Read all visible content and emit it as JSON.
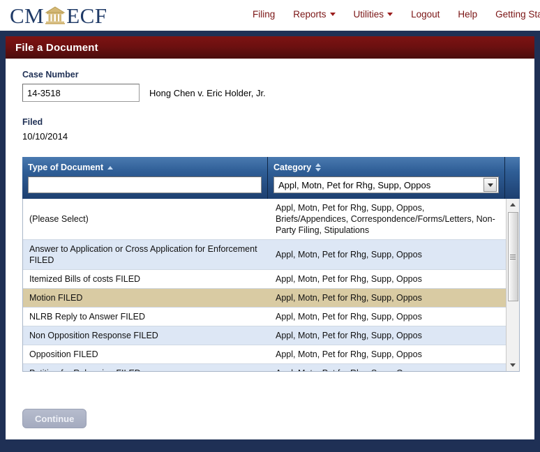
{
  "brand": {
    "part1": "CM",
    "part2": "ECF",
    "icon": "courthouse-icon"
  },
  "nav": {
    "items": [
      {
        "label": "Filing",
        "caret": false
      },
      {
        "label": "Reports",
        "caret": true
      },
      {
        "label": "Utilities",
        "caret": true
      },
      {
        "label": "Logout",
        "caret": false
      },
      {
        "label": "Help",
        "caret": false
      },
      {
        "label": "Getting Started",
        "caret": false
      }
    ]
  },
  "page": {
    "title": "File a Document"
  },
  "case": {
    "number_label": "Case Number",
    "number_value": "14-3518",
    "number_placeholder": "",
    "caption": "Hong Chen v. Eric Holder, Jr.",
    "filed_label": "Filed",
    "filed_value": "10/10/2014"
  },
  "grid": {
    "columns": [
      {
        "label": "Type of Document",
        "sort": "asc"
      },
      {
        "label": "Category",
        "sort": "none"
      }
    ],
    "filters": {
      "type_value": "",
      "type_placeholder": "",
      "category_value": "Appl, Motn, Pet for Rhg, Supp, Oppos"
    },
    "rows": [
      {
        "type": "(Please Select)",
        "category": "Appl, Motn, Pet for Rhg, Supp, Oppos, Briefs/Appendices, Correspondence/Forms/Letters, Non-Party Filing, Stipulations",
        "style": "plain"
      },
      {
        "type": "Answer to Application or Cross Application for Enforcement FILED",
        "category": "Appl, Motn, Pet for Rhg, Supp, Oppos",
        "style": "alt"
      },
      {
        "type": "Itemized Bills of costs FILED",
        "category": "Appl, Motn, Pet for Rhg, Supp, Oppos",
        "style": "plain"
      },
      {
        "type": "Motion FILED",
        "category": "Appl, Motn, Pet for Rhg, Supp, Oppos",
        "style": "selected"
      },
      {
        "type": "NLRB Reply to Answer FILED",
        "category": "Appl, Motn, Pet for Rhg, Supp, Oppos",
        "style": "plain"
      },
      {
        "type": "Non Opposition Response FILED",
        "category": "Appl, Motn, Pet for Rhg, Supp, Oppos",
        "style": "alt"
      },
      {
        "type": "Opposition FILED",
        "category": "Appl, Motn, Pet for Rhg, Supp, Oppos",
        "style": "plain"
      },
      {
        "type": "Petition for Rehearing FILED",
        "category": "Appl, Motn, Pet for Rhg, Supp, Oppos",
        "style": "alt"
      }
    ]
  },
  "footer": {
    "continue_label": "Continue"
  },
  "colors": {
    "brand_navy": "#1f3a67",
    "nav_link": "#7a1414",
    "title_red": "#6d1010",
    "header_blue": "#2f5e96",
    "row_alt": "#dde7f5",
    "row_selected": "#d9cba3",
    "frame_navy": "#1f3055"
  }
}
